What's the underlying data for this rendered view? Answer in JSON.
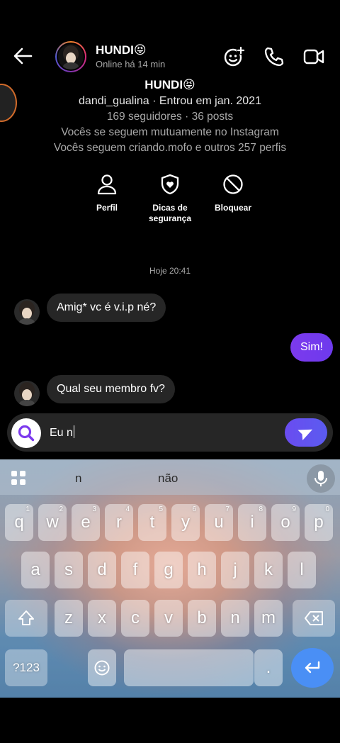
{
  "header": {
    "contact_name": "HUNDI😝",
    "status": "Online há 14 min"
  },
  "profile": {
    "name": "HUNDI😝",
    "handle_line": "dandi_gualina · Entrou em jan. 2021",
    "stats_line": "169 seguidores · 36 posts",
    "mutual_line": "Vocês se seguem mutuamente no Instagram",
    "followers_line": "Vocês seguem criando.mofo e outros 257 perfis"
  },
  "actions": [
    {
      "label": "Perfil"
    },
    {
      "label": "Dicas de segurança"
    },
    {
      "label": "Bloquear"
    }
  ],
  "chat": {
    "timestamp": "Hoje 20:41",
    "messages": [
      {
        "from": "them",
        "text": "Amig* vc é v.i.p né?"
      },
      {
        "from": "me",
        "text": "Sim!"
      },
      {
        "from": "them",
        "text": "Qual seu membro fv?"
      }
    ]
  },
  "composer": {
    "value": "Eu n"
  },
  "keyboard": {
    "suggestions": [
      "n",
      "não"
    ],
    "row1": [
      {
        "k": "q",
        "n": "1"
      },
      {
        "k": "w",
        "n": "2"
      },
      {
        "k": "e",
        "n": "3"
      },
      {
        "k": "r",
        "n": "4"
      },
      {
        "k": "t",
        "n": "5"
      },
      {
        "k": "y",
        "n": "6"
      },
      {
        "k": "u",
        "n": "7"
      },
      {
        "k": "i",
        "n": "8"
      },
      {
        "k": "o",
        "n": "9"
      },
      {
        "k": "p",
        "n": "0"
      }
    ],
    "row2": [
      "a",
      "s",
      "d",
      "f",
      "g",
      "h",
      "j",
      "k",
      "l"
    ],
    "row3": [
      "z",
      "x",
      "c",
      "v",
      "b",
      "n",
      "m"
    ],
    "symbols_label": "?123"
  },
  "colors": {
    "accent_purple": "#7c3aed",
    "accent_blue_purple": "#5b5bf0",
    "enter_blue": "#4a8ff5"
  }
}
